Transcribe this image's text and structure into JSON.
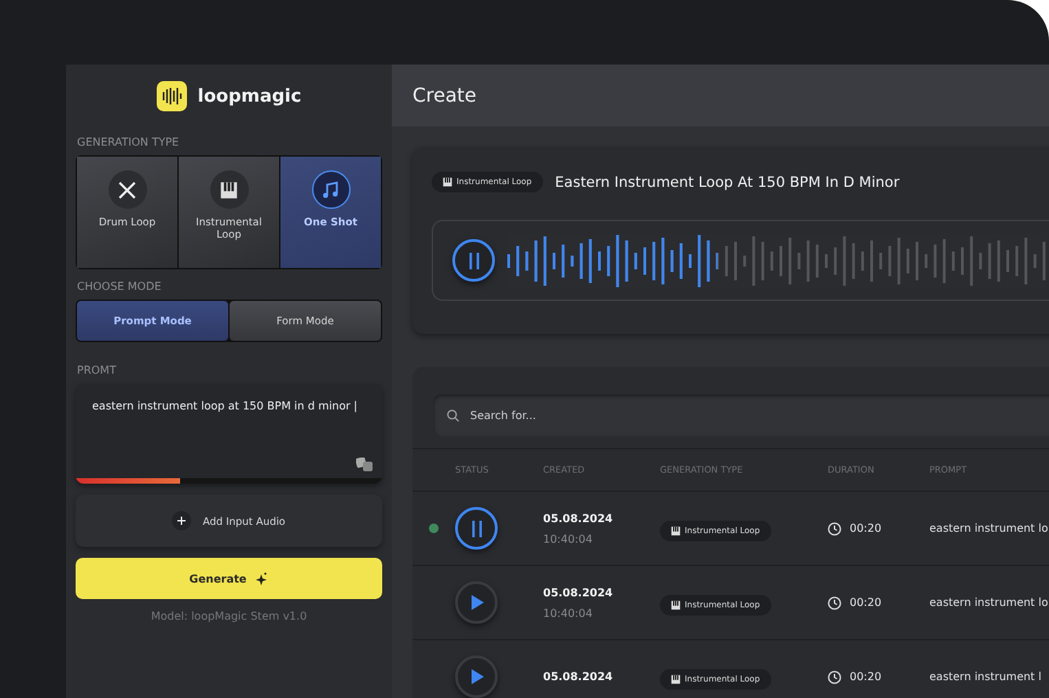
{
  "brand": {
    "name": "loopmagic"
  },
  "sidebar": {
    "generation_type": {
      "label": "GENERATION TYPE",
      "options": [
        {
          "label": "Drum Loop",
          "kind": "drum",
          "selected": false
        },
        {
          "label": "Instrumental Loop",
          "kind": "piano",
          "selected": false
        },
        {
          "label": "One Shot",
          "kind": "note",
          "selected": true
        }
      ]
    },
    "mode": {
      "label": "CHOOSE MODE",
      "options": [
        {
          "label": "Prompt Mode",
          "selected": true
        },
        {
          "label": "Form Mode",
          "selected": false
        }
      ]
    },
    "prompt": {
      "label": "PROMT",
      "value": "eastern instrument loop at 150 BPM in d minor |",
      "level": 0.34
    },
    "add_audio": "Add Input Audio",
    "generate": "Generate",
    "model": "Model: loopMagic Stem v1.0"
  },
  "header": {
    "title": "Create"
  },
  "player": {
    "badge": "Instrumental Loop",
    "title": "Eastern Instrument Loop At 150 BPM In D Minor",
    "playing": true,
    "level": 0.39
  },
  "search": {
    "placeholder": "Search for..."
  },
  "table": {
    "columns": [
      "STATUS",
      "CREATED",
      "GENERATION TYPE",
      "DURATION",
      "PROMPT"
    ],
    "rows": [
      {
        "active": true,
        "playing": true,
        "date": "05.08.2024",
        "time": "10:40:04",
        "type": "Instrumental Loop",
        "duration": "00:20",
        "prompt": "eastern instrument lo"
      },
      {
        "active": false,
        "playing": false,
        "date": "05.08.2024",
        "time": "10:40:04",
        "type": "Instrumental Loop",
        "duration": "00:20",
        "prompt": "eastern instrument lo"
      },
      {
        "active": false,
        "playing": false,
        "date": "05.08.2024",
        "type": "Instrumental Loop",
        "duration": "00:20",
        "prompt": "eastern instrument l"
      }
    ]
  }
}
